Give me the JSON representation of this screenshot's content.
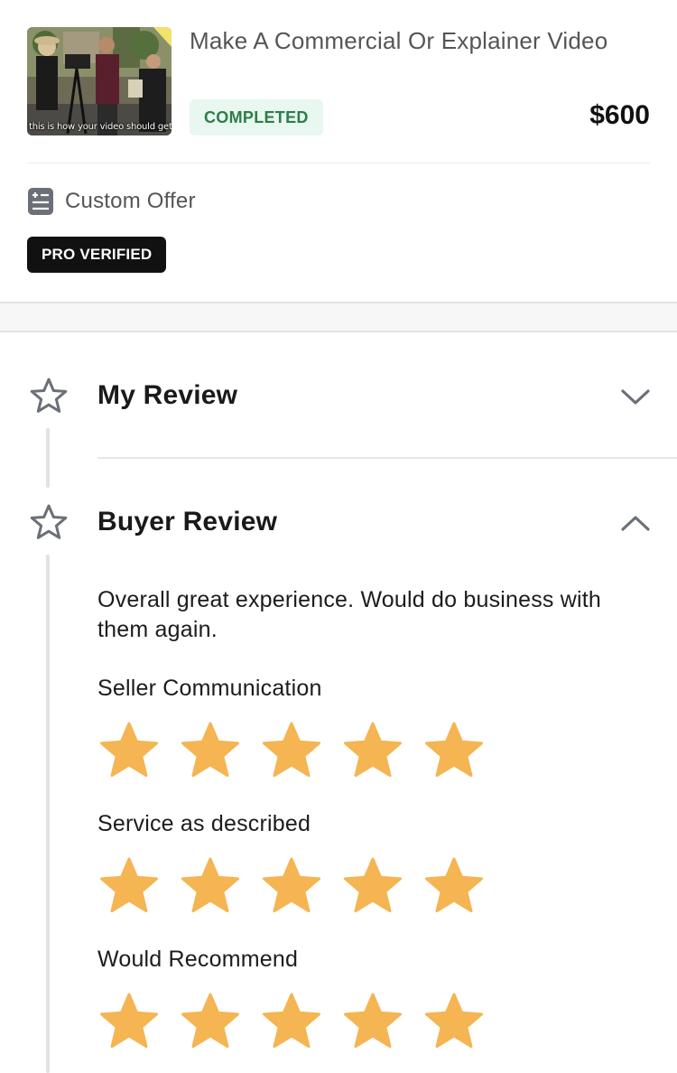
{
  "order": {
    "thumbnail_caption": "this is how your video should get m",
    "title": "Make A Commercial Or Explainer Video",
    "status": "COMPLETED",
    "price": "$600",
    "offer_type": "Custom Offer",
    "badge": "PRO VERIFIED"
  },
  "reviews": {
    "my_review": {
      "title": "My Review",
      "expanded": false
    },
    "buyer_review": {
      "title": "Buyer Review",
      "expanded": true,
      "text": "Overall great experience. Would do business with them again.",
      "criteria": [
        {
          "label": "Seller Communication",
          "rating": 5,
          "max": 5
        },
        {
          "label": "Service as described",
          "rating": 5,
          "max": 5
        },
        {
          "label": "Would Recommend",
          "rating": 5,
          "max": 5
        }
      ]
    }
  },
  "colors": {
    "status_bg": "#e8f7ef",
    "status_text": "#2e7d4a",
    "star_fill": "#f4b552",
    "badge_bg": "#111111",
    "icon_gray": "#6b6f78"
  },
  "icons": {
    "offer": "list-document-icon",
    "section": "star-outline-icon",
    "collapsed": "chevron-down-icon",
    "expanded": "chevron-up-icon"
  }
}
